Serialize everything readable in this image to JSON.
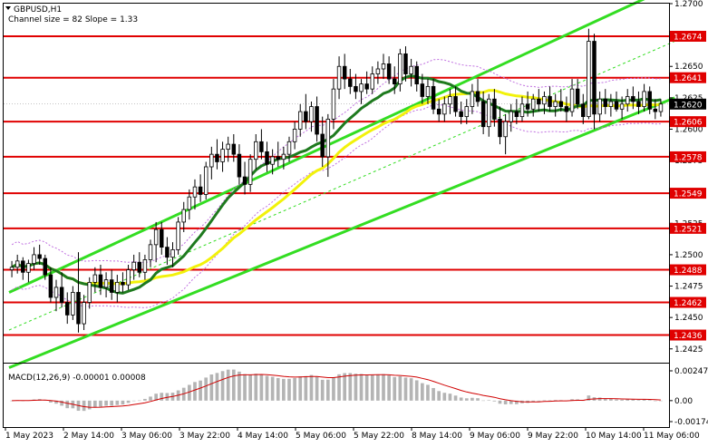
{
  "header": {
    "symbol_label": "GBPUSD,H1",
    "indicator_label": "Channel size = 82 Slope = 1.33"
  },
  "macd": {
    "label": "MACD(12,26,9) -0.00001 0.00008",
    "levels": [
      0.00247,
      0.0,
      -0.00174
    ],
    "level_labels": [
      "0.00247",
      "0.00",
      "-0.00174"
    ],
    "colors": {
      "histogram": "#b4b4b4",
      "signal": "#d00000"
    }
  },
  "colors": {
    "bull_body": "#ffffff",
    "bear_body": "#000000",
    "candle_outline": "#000000",
    "support_resistance": "#e00000",
    "channel": "#33dd22",
    "ma_fast": "#1e7a1e",
    "ma_slow": "#f2f20a",
    "envelope": "#c070e0",
    "price_tag": "#000000"
  },
  "chart_data": {
    "type": "candlestick",
    "price_axis": {
      "ylim": [
        1.2414,
        1.27
      ],
      "ticks": [
        1.27,
        1.2675,
        1.265,
        1.2625,
        1.26,
        1.2575,
        1.255,
        1.2525,
        1.25,
        1.2475,
        1.245,
        1.2425
      ],
      "tick_labels": [
        "1.2700",
        "1.2675",
        "1.2650",
        "1.2625",
        "1.2600",
        "1.2575",
        "1.2550",
        "1.2525",
        "1.2500",
        "1.2475",
        "1.2450",
        "1.2425"
      ]
    },
    "time_axis": {
      "labels": [
        "1 May 2023",
        "2 May 14:00",
        "3 May 06:00",
        "3 May 22:00",
        "4 May 14:00",
        "5 May 06:00",
        "5 May 22:00",
        "8 May 14:00",
        "9 May 06:00",
        "9 May 22:00",
        "10 May 14:00",
        "11 May 06:00"
      ]
    },
    "horizontal_levels": [
      {
        "value": 1.2674,
        "label": "1.2674"
      },
      {
        "value": 1.2641,
        "label": "1.2641"
      },
      {
        "value": 1.2606,
        "label": "1.2606"
      },
      {
        "value": 1.2578,
        "label": "1.2578"
      },
      {
        "value": 1.2549,
        "label": "1.2549"
      },
      {
        "value": 1.2521,
        "label": "1.2521"
      },
      {
        "value": 1.2488,
        "label": "1.2488"
      },
      {
        "value": 1.2462,
        "label": "1.2462"
      },
      {
        "value": 1.2436,
        "label": "1.2436"
      }
    ],
    "current_price": {
      "value": 1.262,
      "label": "1.2620"
    },
    "channel": {
      "start_candle": 0,
      "end_candle": 119,
      "upper": [
        1.247,
        1.2715
      ],
      "lower": [
        1.241,
        1.2625
      ],
      "mid": [
        1.244,
        1.267
      ]
    },
    "candles": [
      [
        1.2488,
        1.2495,
        1.2482,
        1.249
      ],
      [
        1.249,
        1.25,
        1.2485,
        1.2495
      ],
      [
        1.2495,
        1.2498,
        1.248,
        1.2486
      ],
      [
        1.2486,
        1.2496,
        1.2478,
        1.2493
      ],
      [
        1.2493,
        1.2506,
        1.2488,
        1.25
      ],
      [
        1.25,
        1.2508,
        1.2492,
        1.2497
      ],
      [
        1.2497,
        1.25,
        1.248,
        1.2484
      ],
      [
        1.2484,
        1.249,
        1.2462,
        1.2466
      ],
      [
        1.2466,
        1.248,
        1.2455,
        1.2474
      ],
      [
        1.2474,
        1.2486,
        1.2458,
        1.2462
      ],
      [
        1.2462,
        1.247,
        1.2445,
        1.2452
      ],
      [
        1.2452,
        1.2475,
        1.2448,
        1.247
      ],
      [
        1.247,
        1.2502,
        1.2438,
        1.2445
      ],
      [
        1.2445,
        1.2468,
        1.244,
        1.2462
      ],
      [
        1.2462,
        1.2482,
        1.2457,
        1.2478
      ],
      [
        1.2478,
        1.249,
        1.247,
        1.2484
      ],
      [
        1.2484,
        1.2492,
        1.2468,
        1.2474
      ],
      [
        1.2474,
        1.2486,
        1.2466,
        1.248
      ],
      [
        1.248,
        1.2488,
        1.2464,
        1.247
      ],
      [
        1.247,
        1.2484,
        1.2462,
        1.2478
      ],
      [
        1.2478,
        1.2486,
        1.247,
        1.2476
      ],
      [
        1.2476,
        1.2492,
        1.2472,
        1.2488
      ],
      [
        1.2488,
        1.25,
        1.248,
        1.2494
      ],
      [
        1.2494,
        1.2502,
        1.2482,
        1.2486
      ],
      [
        1.2486,
        1.25,
        1.248,
        1.2496
      ],
      [
        1.2496,
        1.2512,
        1.249,
        1.2508
      ],
      [
        1.2508,
        1.2526,
        1.2494,
        1.252
      ],
      [
        1.252,
        1.2526,
        1.25,
        1.2506
      ],
      [
        1.2506,
        1.2514,
        1.2492,
        1.2498
      ],
      [
        1.2498,
        1.251,
        1.249,
        1.2504
      ],
      [
        1.2504,
        1.253,
        1.25,
        1.2526
      ],
      [
        1.2526,
        1.2542,
        1.2518,
        1.2536
      ],
      [
        1.2536,
        1.2552,
        1.2528,
        1.2546
      ],
      [
        1.2546,
        1.256,
        1.2536,
        1.2554
      ],
      [
        1.2554,
        1.2564,
        1.2542,
        1.2548
      ],
      [
        1.2548,
        1.2574,
        1.2544,
        1.257
      ],
      [
        1.257,
        1.2586,
        1.256,
        1.258
      ],
      [
        1.258,
        1.2592,
        1.2568,
        1.2574
      ],
      [
        1.2574,
        1.259,
        1.2566,
        1.2584
      ],
      [
        1.2584,
        1.2594,
        1.2574,
        1.2588
      ],
      [
        1.2588,
        1.2596,
        1.2574,
        1.258
      ],
      [
        1.258,
        1.2588,
        1.2556,
        1.2562
      ],
      [
        1.2562,
        1.2574,
        1.2548,
        1.2556
      ],
      [
        1.2556,
        1.258,
        1.255,
        1.2576
      ],
      [
        1.2576,
        1.2596,
        1.2568,
        1.259
      ],
      [
        1.259,
        1.26,
        1.2576,
        1.2582
      ],
      [
        1.2582,
        1.259,
        1.2566,
        1.2572
      ],
      [
        1.2572,
        1.2584,
        1.2564,
        1.2578
      ],
      [
        1.2578,
        1.259,
        1.257,
        1.2576
      ],
      [
        1.2576,
        1.2586,
        1.2568,
        1.258
      ],
      [
        1.258,
        1.2594,
        1.2574,
        1.259
      ],
      [
        1.259,
        1.2606,
        1.2584,
        1.26
      ],
      [
        1.26,
        1.262,
        1.2594,
        1.2614
      ],
      [
        1.2614,
        1.2628,
        1.26,
        1.2606
      ],
      [
        1.2606,
        1.2622,
        1.2598,
        1.2618
      ],
      [
        1.2618,
        1.2626,
        1.259,
        1.2596
      ],
      [
        1.2596,
        1.261,
        1.257,
        1.2578
      ],
      [
        1.2578,
        1.2612,
        1.2562,
        1.2608
      ],
      [
        1.2608,
        1.264,
        1.26,
        1.2632
      ],
      [
        1.2632,
        1.2658,
        1.2624,
        1.265
      ],
      [
        1.265,
        1.266,
        1.2632,
        1.264
      ],
      [
        1.264,
        1.2648,
        1.2628,
        1.2634
      ],
      [
        1.2634,
        1.2644,
        1.2624,
        1.263
      ],
      [
        1.263,
        1.264,
        1.262,
        1.2636
      ],
      [
        1.2636,
        1.2646,
        1.2628,
        1.2632
      ],
      [
        1.2632,
        1.265,
        1.2628,
        1.2644
      ],
      [
        1.2644,
        1.2654,
        1.2636,
        1.2648
      ],
      [
        1.2648,
        1.266,
        1.264,
        1.2652
      ],
      [
        1.2652,
        1.2658,
        1.2636,
        1.264
      ],
      [
        1.264,
        1.265,
        1.2628,
        1.2636
      ],
      [
        1.2636,
        1.2664,
        1.263,
        1.266
      ],
      [
        1.266,
        1.2666,
        1.2638,
        1.2644
      ],
      [
        1.2644,
        1.2656,
        1.2634,
        1.265
      ],
      [
        1.265,
        1.2654,
        1.263,
        1.2636
      ],
      [
        1.2636,
        1.2644,
        1.262,
        1.2626
      ],
      [
        1.2626,
        1.264,
        1.262,
        1.2634
      ],
      [
        1.2634,
        1.264,
        1.2612,
        1.2616
      ],
      [
        1.2616,
        1.2624,
        1.2606,
        1.2612
      ],
      [
        1.2612,
        1.2626,
        1.2606,
        1.262
      ],
      [
        1.262,
        1.2632,
        1.2612,
        1.2626
      ],
      [
        1.2626,
        1.2634,
        1.261,
        1.2614
      ],
      [
        1.2614,
        1.2622,
        1.2604,
        1.261
      ],
      [
        1.261,
        1.2624,
        1.2604,
        1.2618
      ],
      [
        1.2618,
        1.2636,
        1.2612,
        1.263
      ],
      [
        1.263,
        1.264,
        1.2618,
        1.2622
      ],
      [
        1.2622,
        1.263,
        1.2596,
        1.2602
      ],
      [
        1.2602,
        1.2628,
        1.2594,
        1.2624
      ],
      [
        1.2624,
        1.2632,
        1.2602,
        1.2608
      ],
      [
        1.2608,
        1.2618,
        1.2588,
        1.2594
      ],
      [
        1.2594,
        1.2612,
        1.258,
        1.2606
      ],
      [
        1.2606,
        1.262,
        1.2598,
        1.2614
      ],
      [
        1.2614,
        1.2624,
        1.2604,
        1.261
      ],
      [
        1.261,
        1.2626,
        1.2606,
        1.262
      ],
      [
        1.262,
        1.263,
        1.261,
        1.2616
      ],
      [
        1.2616,
        1.2628,
        1.261,
        1.2624
      ],
      [
        1.2624,
        1.2632,
        1.2614,
        1.262
      ],
      [
        1.262,
        1.263,
        1.2612,
        1.2626
      ],
      [
        1.2626,
        1.2634,
        1.2614,
        1.2618
      ],
      [
        1.2618,
        1.2628,
        1.261,
        1.2622
      ],
      [
        1.2622,
        1.2632,
        1.2614,
        1.2618
      ],
      [
        1.2618,
        1.2626,
        1.2606,
        1.2614
      ],
      [
        1.2614,
        1.264,
        1.261,
        1.2632
      ],
      [
        1.2632,
        1.264,
        1.2616,
        1.262
      ],
      [
        1.262,
        1.2628,
        1.2604,
        1.261
      ],
      [
        1.261,
        1.268,
        1.2608,
        1.267
      ],
      [
        1.267,
        1.2676,
        1.26,
        1.2612
      ],
      [
        1.2612,
        1.263,
        1.2606,
        1.2624
      ],
      [
        1.2624,
        1.2632,
        1.2612,
        1.2618
      ],
      [
        1.2618,
        1.2628,
        1.261,
        1.2622
      ],
      [
        1.2622,
        1.263,
        1.2614,
        1.2616
      ],
      [
        1.2616,
        1.2626,
        1.2608,
        1.262
      ],
      [
        1.262,
        1.2632,
        1.2614,
        1.2626
      ],
      [
        1.2626,
        1.2634,
        1.2616,
        1.2622
      ],
      [
        1.2622,
        1.263,
        1.2612,
        1.2618
      ],
      [
        1.2618,
        1.2636,
        1.2614,
        1.263
      ],
      [
        1.263,
        1.2634,
        1.2612,
        1.2616
      ],
      [
        1.2616,
        1.2624,
        1.2608,
        1.2614
      ],
      [
        1.2614,
        1.2624,
        1.261,
        1.262
      ]
    ]
  }
}
